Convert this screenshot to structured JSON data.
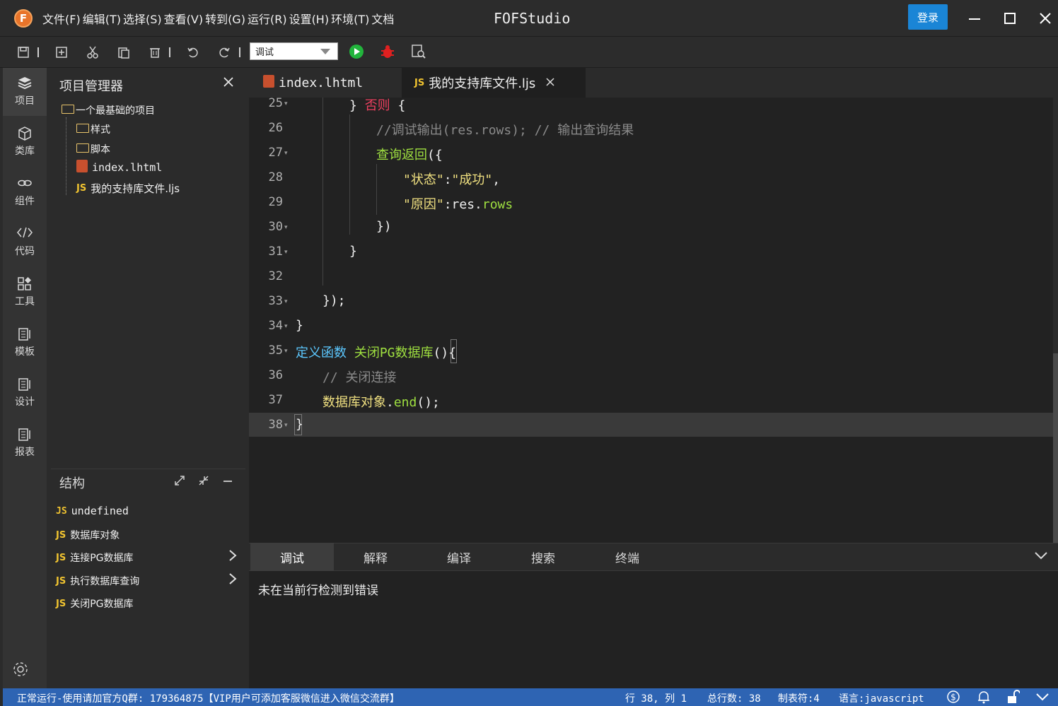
{
  "titlebar": {
    "logo": "F",
    "menu": [
      "文件(F)",
      "编辑(T)",
      "选择(S)",
      "查看(V)",
      "转到(G)",
      "运行(R)",
      "设置(H)",
      "环境(T)",
      "文档"
    ],
    "app_title": "FOFStudio",
    "login_label": "登录"
  },
  "toolbar": {
    "run_config": "调试"
  },
  "activity": {
    "items": [
      {
        "label": "项目",
        "icon": "layers-icon"
      },
      {
        "label": "类库",
        "icon": "cube-icon"
      },
      {
        "label": "组件",
        "icon": "link-icon"
      },
      {
        "label": "代码",
        "icon": "code-icon"
      },
      {
        "label": "工具",
        "icon": "grid-icon"
      },
      {
        "label": "模板",
        "icon": "book-icon"
      },
      {
        "label": "设计",
        "icon": "book-icon"
      },
      {
        "label": "报表",
        "icon": "book-icon"
      }
    ]
  },
  "project": {
    "title": "项目管理器",
    "tree": [
      {
        "label": "一个最基础的项目",
        "type": "folder"
      },
      {
        "label": "样式",
        "type": "folder"
      },
      {
        "label": "脚本",
        "type": "folder"
      },
      {
        "label": "index.lhtml",
        "type": "html"
      },
      {
        "label": "我的支持库文件.ljs",
        "type": "js"
      }
    ]
  },
  "structure": {
    "title": "结构",
    "items": [
      {
        "label": "undefined",
        "expandable": false
      },
      {
        "label": "数据库对象",
        "expandable": false
      },
      {
        "label": "连接PG数据库",
        "expandable": true
      },
      {
        "label": "执行数据库查询",
        "expandable": true
      },
      {
        "label": "关闭PG数据库",
        "expandable": false
      }
    ]
  },
  "editor": {
    "tabs": [
      {
        "label": "index.lhtml",
        "active": false
      },
      {
        "label": "我的支持库文件.ljs",
        "active": true
      }
    ],
    "lines": [
      {
        "n": "25",
        "code": [
          {
            "t": "} ",
            "c": "c-white"
          },
          {
            "t": "否则",
            "c": "c-red"
          },
          {
            "t": " {",
            "c": "c-white"
          }
        ]
      },
      {
        "n": "26",
        "code": [
          {
            "t": "//调试输出(res.rows); // 输出查询结果",
            "c": "c-comment"
          }
        ]
      },
      {
        "n": "27",
        "code": [
          {
            "t": "查询返回",
            "c": "c-green"
          },
          {
            "t": "({",
            "c": "c-white"
          }
        ]
      },
      {
        "n": "28",
        "code": [
          {
            "t": "\"状态\"",
            "c": "c-yellow"
          },
          {
            "t": ":",
            "c": "c-white"
          },
          {
            "t": "\"成功\"",
            "c": "c-yellow"
          },
          {
            "t": ",",
            "c": "c-white"
          }
        ]
      },
      {
        "n": "29",
        "code": [
          {
            "t": "\"原因\"",
            "c": "c-yellow"
          },
          {
            "t": ":res.",
            "c": "c-white"
          },
          {
            "t": "rows",
            "c": "c-green"
          }
        ]
      },
      {
        "n": "30",
        "code": [
          {
            "t": "})",
            "c": "c-white"
          }
        ]
      },
      {
        "n": "31",
        "code": [
          {
            "t": "}",
            "c": "c-white"
          }
        ]
      },
      {
        "n": "32",
        "code": []
      },
      {
        "n": "33",
        "code": [
          {
            "t": "});",
            "c": "c-white"
          }
        ]
      },
      {
        "n": "34",
        "code": [
          {
            "t": "}",
            "c": "c-white"
          }
        ]
      },
      {
        "n": "35",
        "code": [
          {
            "t": "定义函数",
            "c": "c-blue"
          },
          {
            "t": " ",
            "c": "c-white"
          },
          {
            "t": "关闭PG数据库",
            "c": "c-green"
          },
          {
            "t": "(){",
            "c": "c-white"
          }
        ]
      },
      {
        "n": "36",
        "code": [
          {
            "t": "// 关闭连接",
            "c": "c-comment"
          }
        ]
      },
      {
        "n": "37",
        "code": [
          {
            "t": "数据库对象",
            "c": "c-yellow"
          },
          {
            "t": ".",
            "c": "c-white"
          },
          {
            "t": "end",
            "c": "c-green"
          },
          {
            "t": "();",
            "c": "c-white"
          }
        ]
      },
      {
        "n": "38",
        "code": [
          {
            "t": "}",
            "c": "c-white"
          }
        ]
      }
    ]
  },
  "bottom_panel": {
    "tabs": [
      "调试",
      "解释",
      "编译",
      "搜索",
      "终端"
    ],
    "active_tab": "调试",
    "message": "未在当前行检测到错误"
  },
  "statusbar": {
    "left": "正常运行-使用请加官方Q群: 179364875【VIP用户可添加客服微信进入微信交流群】",
    "position": "行 38, 列 1",
    "total_lines": "总行数: 38",
    "tab_size": "制表符:4",
    "language": "语言:javascript"
  },
  "colors": {
    "accent": "#2e64b3",
    "login": "#1a85d6"
  }
}
